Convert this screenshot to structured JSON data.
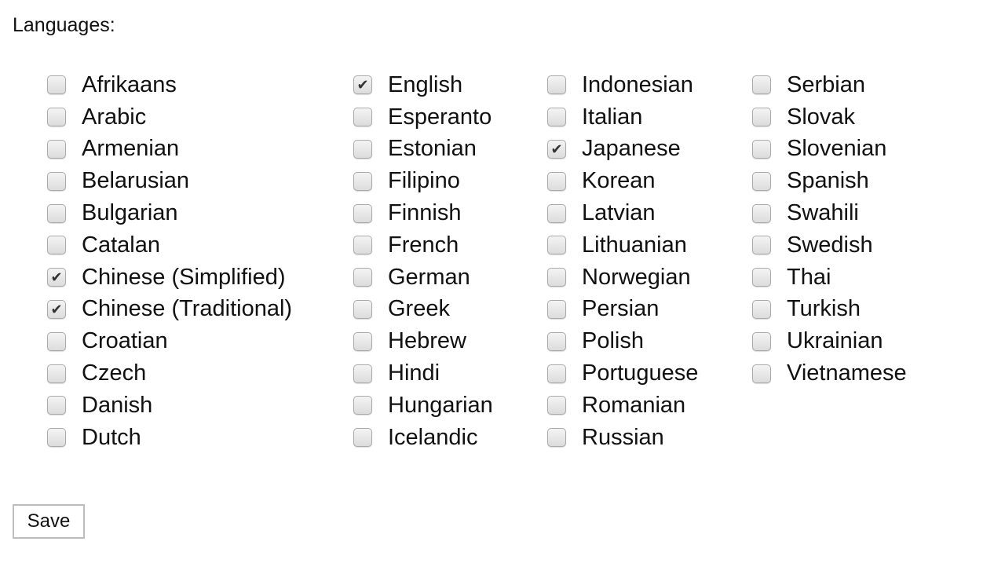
{
  "form": {
    "title": "Languages:",
    "save_label": "Save"
  },
  "columns": [
    [
      {
        "label": "Afrikaans",
        "checked": false
      },
      {
        "label": "Arabic",
        "checked": false
      },
      {
        "label": "Armenian",
        "checked": false
      },
      {
        "label": "Belarusian",
        "checked": false
      },
      {
        "label": "Bulgarian",
        "checked": false
      },
      {
        "label": "Catalan",
        "checked": false
      },
      {
        "label": "Chinese (Simplified)",
        "checked": true
      },
      {
        "label": "Chinese (Traditional)",
        "checked": true
      },
      {
        "label": "Croatian",
        "checked": false
      },
      {
        "label": "Czech",
        "checked": false
      },
      {
        "label": "Danish",
        "checked": false
      },
      {
        "label": "Dutch",
        "checked": false
      }
    ],
    [
      {
        "label": "English",
        "checked": true
      },
      {
        "label": "Esperanto",
        "checked": false
      },
      {
        "label": "Estonian",
        "checked": false
      },
      {
        "label": "Filipino",
        "checked": false
      },
      {
        "label": "Finnish",
        "checked": false
      },
      {
        "label": "French",
        "checked": false
      },
      {
        "label": "German",
        "checked": false
      },
      {
        "label": "Greek",
        "checked": false
      },
      {
        "label": "Hebrew",
        "checked": false
      },
      {
        "label": "Hindi",
        "checked": false
      },
      {
        "label": "Hungarian",
        "checked": false
      },
      {
        "label": "Icelandic",
        "checked": false
      }
    ],
    [
      {
        "label": "Indonesian",
        "checked": false
      },
      {
        "label": "Italian",
        "checked": false
      },
      {
        "label": "Japanese",
        "checked": true
      },
      {
        "label": "Korean",
        "checked": false
      },
      {
        "label": "Latvian",
        "checked": false
      },
      {
        "label": "Lithuanian",
        "checked": false
      },
      {
        "label": "Norwegian",
        "checked": false
      },
      {
        "label": "Persian",
        "checked": false
      },
      {
        "label": "Polish",
        "checked": false
      },
      {
        "label": "Portuguese",
        "checked": false
      },
      {
        "label": "Romanian",
        "checked": false
      },
      {
        "label": "Russian",
        "checked": false
      }
    ],
    [
      {
        "label": "Serbian",
        "checked": false
      },
      {
        "label": "Slovak",
        "checked": false
      },
      {
        "label": "Slovenian",
        "checked": false
      },
      {
        "label": "Spanish",
        "checked": false
      },
      {
        "label": "Swahili",
        "checked": false
      },
      {
        "label": "Swedish",
        "checked": false
      },
      {
        "label": "Thai",
        "checked": false
      },
      {
        "label": "Turkish",
        "checked": false
      },
      {
        "label": "Ukrainian",
        "checked": false
      },
      {
        "label": "Vietnamese",
        "checked": false
      }
    ]
  ],
  "icons": {
    "check": "✔"
  }
}
